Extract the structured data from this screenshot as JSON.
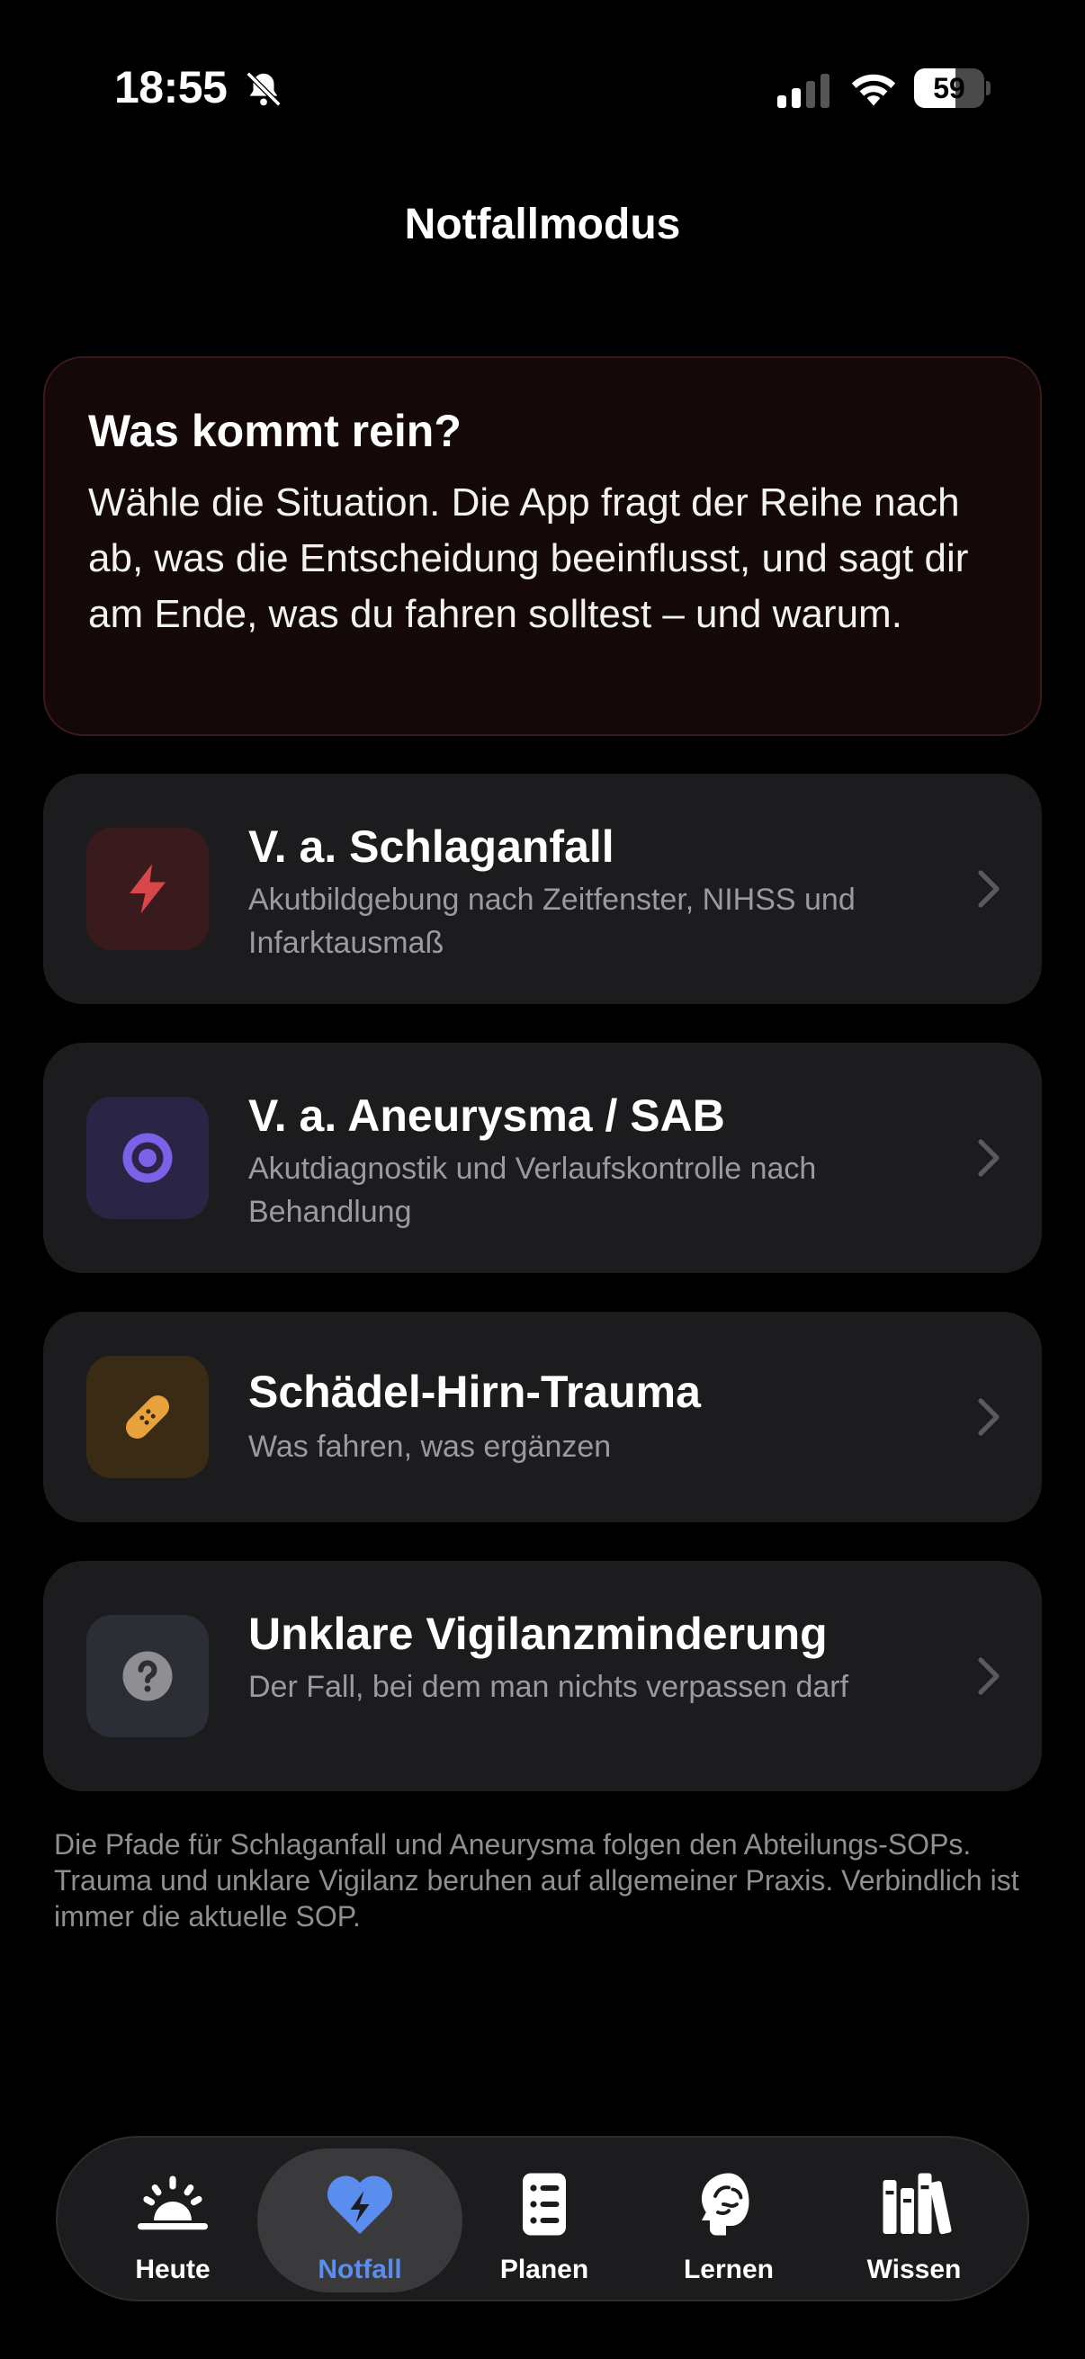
{
  "status_bar": {
    "time": "18:55",
    "battery_level": "59",
    "battery_fraction": 0.59,
    "icons": [
      "bell-slash-icon",
      "cellular-signal-icon",
      "wifi-icon",
      "battery-icon"
    ]
  },
  "header": {
    "title": "Notfallmodus"
  },
  "intro": {
    "heading": "Was kommt rein?",
    "body": "Wähle die Situation. Die App fragt der Reihe nach ab, was die Entscheidung beeinflusst, und sagt dir am Ende, was du fahren solltest – und warum."
  },
  "options": [
    {
      "title": "V. a. Schlaganfall",
      "subtitle": "Akutbildgebung nach Zeitfenster, NIHSS und Infarktausmaß",
      "icon": "lightning-bolt-icon",
      "accent": "#d9464a"
    },
    {
      "title": "V. a. Aneurysma / SAB",
      "subtitle": "Akutdiagnostik und Verlaufskontrolle nach Behandlung",
      "icon": "circle-ring-icon",
      "accent": "#7b61e8"
    },
    {
      "title": "Schädel-Hirn-Trauma",
      "subtitle": "Was fahren, was ergänzen",
      "icon": "bandage-icon",
      "accent": "#e8a23c"
    },
    {
      "title": "Unklare Vigilanzminderung",
      "subtitle": "Der Fall, bei dem man nichts verpassen darf",
      "icon": "question-mark-icon",
      "accent": "#8e8e93"
    }
  ],
  "footer": {
    "note": "Die Pfade für Schlaganfall und Aneurysma folgen den Abteilungs-SOPs. Trauma und unklare Vigilanz beruhen auf allgemeiner Praxis. Verbindlich ist immer die aktuelle SOP."
  },
  "tab_bar": {
    "active": "Notfall",
    "tabs": [
      {
        "label": "Heute",
        "icon": "sunrise-icon"
      },
      {
        "label": "Notfall",
        "icon": "heart-bolt-icon"
      },
      {
        "label": "Planen",
        "icon": "list-clipboard-icon"
      },
      {
        "label": "Lernen",
        "icon": "brain-head-icon"
      },
      {
        "label": "Wissen",
        "icon": "books-icon"
      }
    ]
  },
  "colors": {
    "background": "#000000",
    "card": "#1c1c1e",
    "intro_card": "#140808",
    "active_tab": "#5b8def"
  }
}
